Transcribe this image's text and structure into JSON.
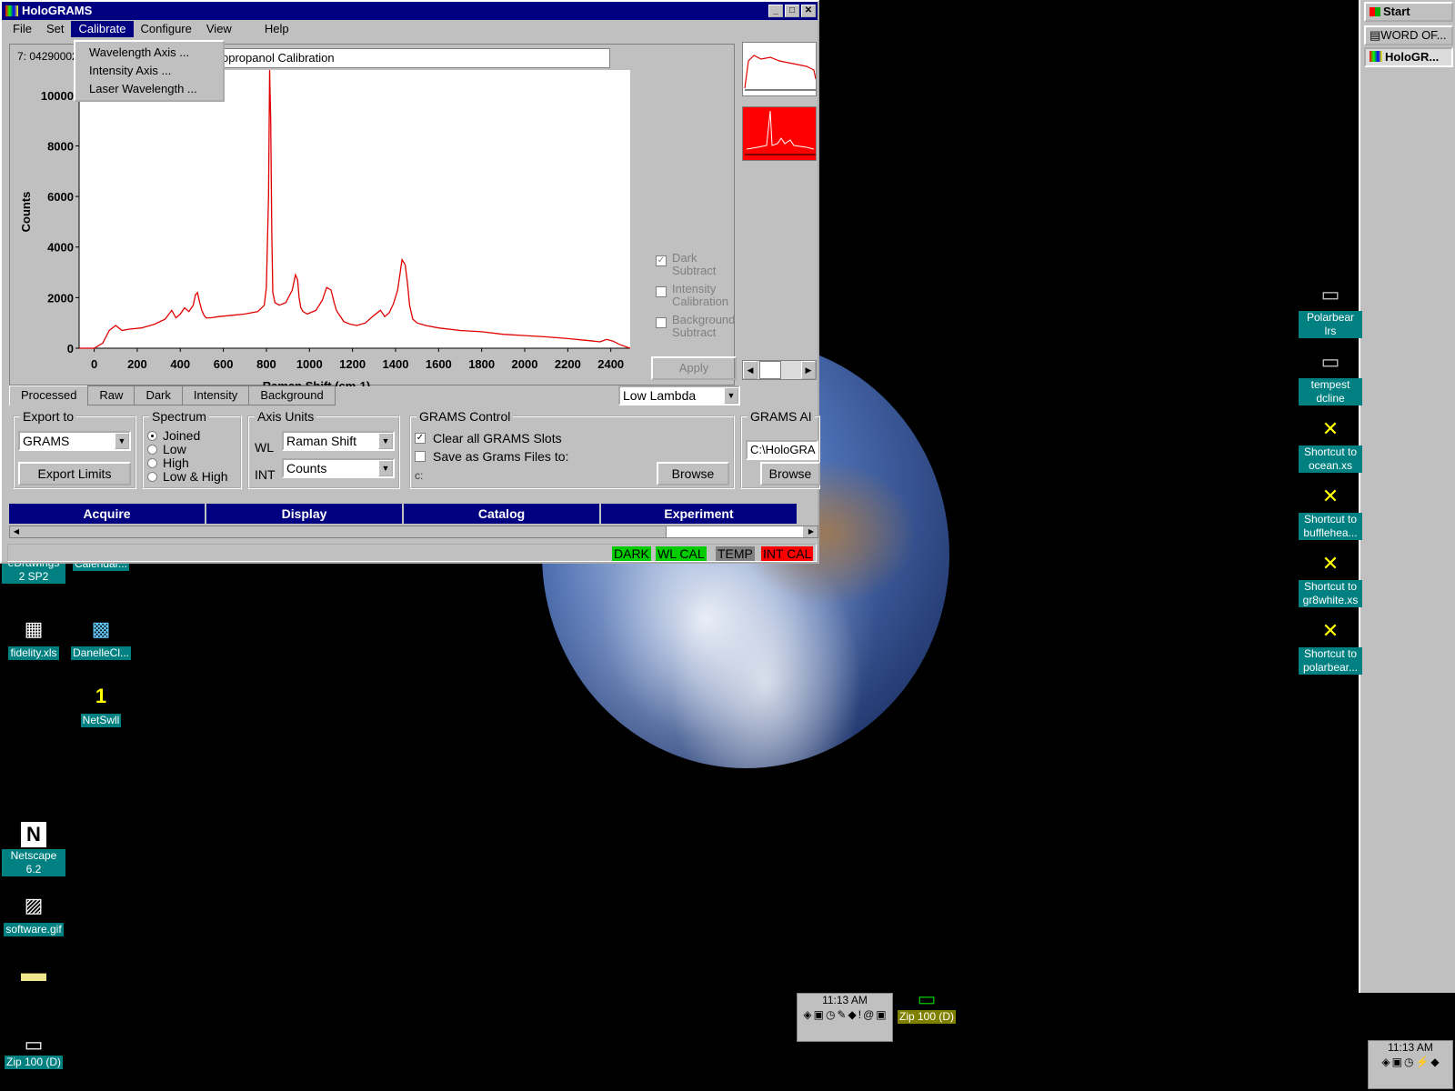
{
  "window": {
    "title": "HoloGRAMS",
    "menu": [
      "File",
      "Set",
      "Calibrate",
      "Configure",
      "View",
      "Help"
    ],
    "calibrate_menu": [
      "Wavelength Axis ...",
      "Intensity Axis ...",
      "Laser Wavelength ..."
    ],
    "spectrum_id": "7: 04290002",
    "spectrum_title": "opropanol Calibration",
    "chart_data": {
      "type": "line",
      "xlabel": "Raman Shift (cm-1)",
      "ylabel": "Counts",
      "xlim": [
        -70,
        2490
      ],
      "ylim": [
        0,
        11000
      ],
      "xticks": [
        "0",
        "200",
        "400",
        "600",
        "800",
        "1000",
        "1200",
        "1400",
        "1600",
        "1800",
        "2000",
        "2200",
        "2400"
      ],
      "yticks": [
        "0",
        "2000",
        "4000",
        "6000",
        "8000",
        "10000"
      ],
      "grid": false,
      "series": [
        {
          "color": "#e00000",
          "x": [
            -70,
            0,
            40,
            70,
            100,
            130,
            160,
            220,
            280,
            330,
            360,
            380,
            400,
            420,
            440,
            460,
            470,
            480,
            490,
            500,
            510,
            520,
            540,
            580,
            640,
            700,
            760,
            790,
            800,
            810,
            815,
            820,
            825,
            830,
            840,
            860,
            890,
            920,
            935,
            945,
            952,
            960,
            970,
            990,
            1030,
            1060,
            1080,
            1100,
            1115,
            1125,
            1140,
            1160,
            1190,
            1220,
            1260,
            1300,
            1330,
            1350,
            1370,
            1390,
            1410,
            1430,
            1445,
            1455,
            1465,
            1480,
            1500,
            1540,
            1600,
            1700,
            1800,
            1900,
            2000,
            2100,
            2200,
            2300,
            2350,
            2380,
            2410,
            2440,
            2490
          ],
          "y": [
            0,
            0,
            200,
            700,
            900,
            700,
            750,
            800,
            950,
            1150,
            1500,
            1200,
            1350,
            1600,
            1450,
            1700,
            2100,
            2200,
            1800,
            1500,
            1300,
            1200,
            1200,
            1250,
            1300,
            1350,
            1450,
            1700,
            2400,
            6000,
            11000,
            9000,
            4500,
            2200,
            1800,
            1700,
            1800,
            2300,
            2900,
            2700,
            2000,
            1600,
            1450,
            1350,
            1500,
            1900,
            2400,
            2300,
            1800,
            1500,
            1300,
            1050,
            950,
            900,
            1000,
            1300,
            1500,
            1250,
            1400,
            1750,
            2300,
            3500,
            3300,
            2600,
            1700,
            1150,
            1000,
            900,
            800,
            700,
            650,
            550,
            500,
            450,
            380,
            300,
            250,
            350,
            280,
            150,
            0
          ]
        }
      ]
    },
    "options": {
      "dark_subtract": "Dark Subtract",
      "intensity_calibration": "Intensity Calibration",
      "background_subtract": "Background Subtract",
      "apply": "Apply"
    },
    "tabs": [
      "Processed",
      "Raw",
      "Dark",
      "Intensity",
      "Background"
    ],
    "lambda_select": "Low Lambda",
    "export": {
      "legend": "Export to",
      "value": "GRAMS",
      "limits_btn": "Export Limits"
    },
    "spectrum": {
      "legend": "Spectrum",
      "options": [
        "Joined",
        "Low",
        "High",
        "Low & High"
      ],
      "selected": "Joined"
    },
    "axis_units": {
      "legend": "Axis Units",
      "wl_label": "WL",
      "wl_value": "Raman Shift",
      "int_label": "INT",
      "int_value": "Counts"
    },
    "grams_control": {
      "legend": "GRAMS Control",
      "clear_slots": "Clear all GRAMS Slots",
      "save_files": "Save as Grams Files to:",
      "path": "c:",
      "browse": "Browse"
    },
    "grams_app": {
      "legend": "GRAMS AI",
      "path": "C:\\HoloGRA",
      "browse": "Browse"
    },
    "nav": [
      "Acquire",
      "Display",
      "Catalog",
      "Experiment"
    ],
    "status": {
      "dark": "DARK",
      "wl_cal": "WL CAL",
      "temp": "TEMP",
      "int_cal": "INT CAL"
    }
  },
  "taskbar": {
    "start": "Start",
    "items": [
      "WORD OF...",
      "HoloGR..."
    ],
    "time": "11:13 AM"
  },
  "desktop_icons": {
    "right": [
      "Polarbear lrs",
      "tempest dcline",
      "Shortcut to ocean.xs",
      "Shortcut to bufflehea...",
      "Shortcut to gr8white.xs",
      "Shortcut to polarbear..."
    ],
    "left": [
      "eDrawings 2 SP2",
      "Calendar...",
      "fidelity.xls",
      "DanelleCl...",
      "NetSwll",
      "Netscape 6.2",
      "software.gif",
      "Zip 100 (D)"
    ],
    "middle": [
      "Zip 100 (D)"
    ]
  },
  "tray": {
    "time": "11:13 AM"
  },
  "colors": {
    "title": "#000080",
    "desktop": "#000000",
    "label_bg": "#008080",
    "plot_line": "#e00000"
  }
}
